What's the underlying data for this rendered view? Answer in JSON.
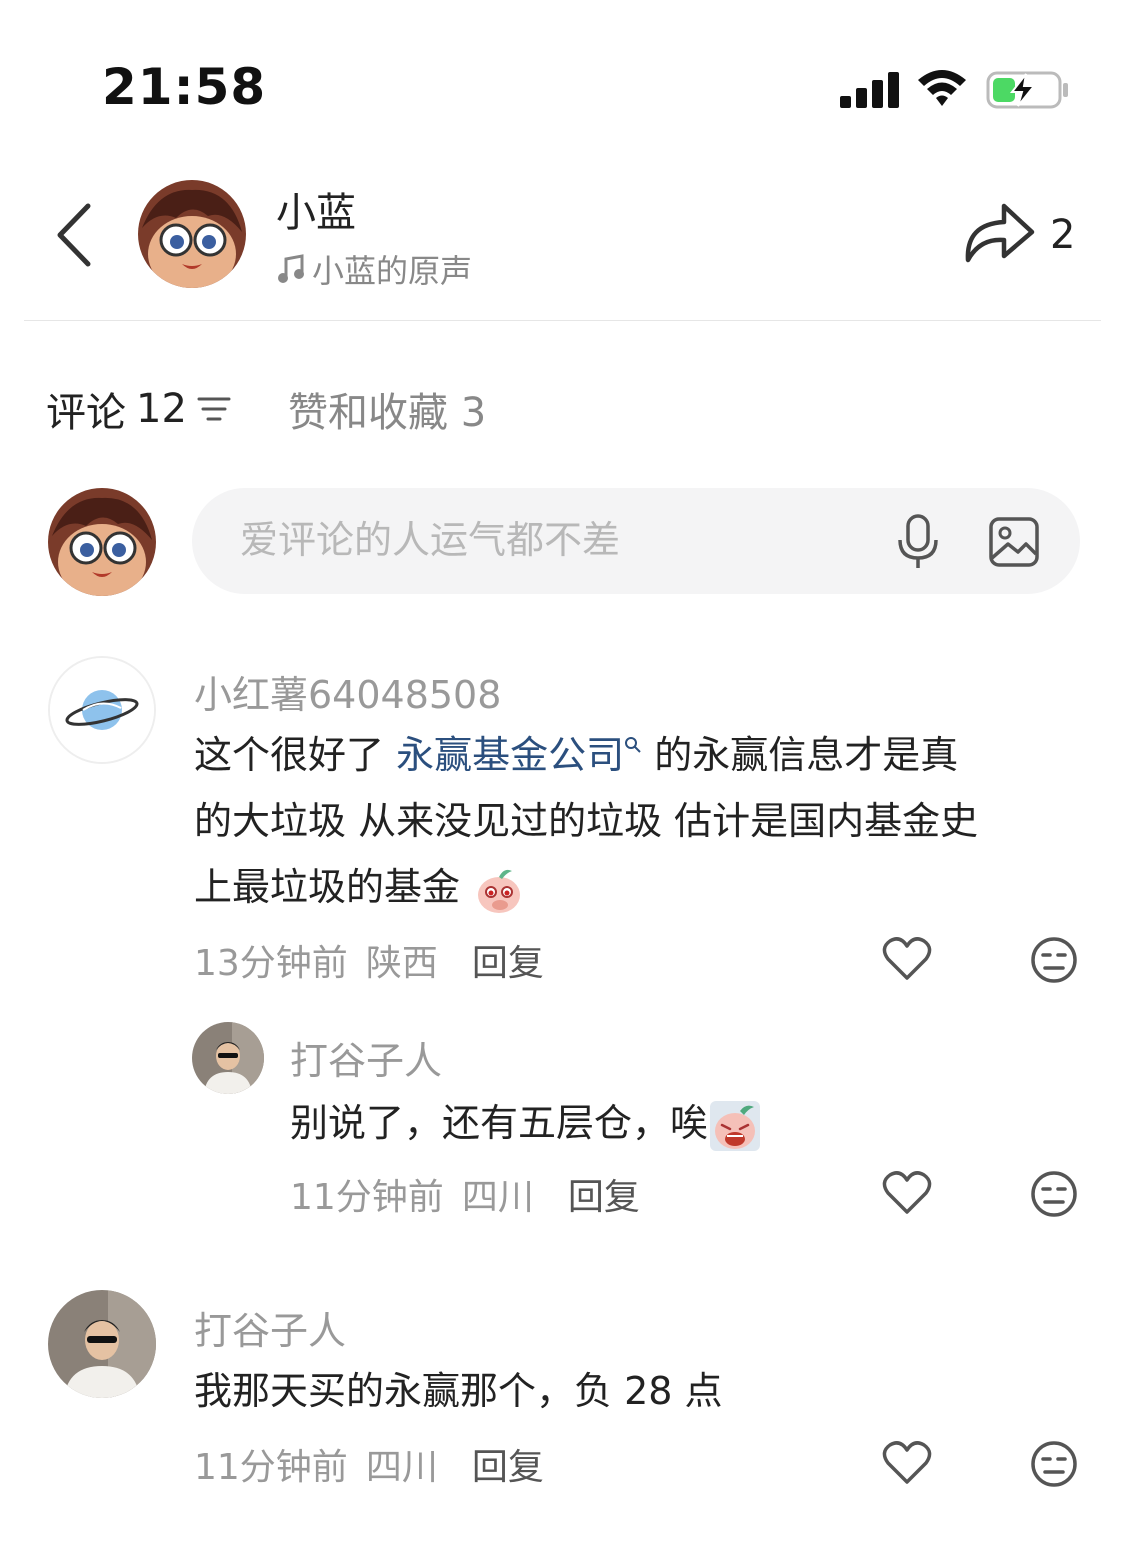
{
  "status_bar": {
    "time": "21:58"
  },
  "header": {
    "username": "小蓝",
    "sound": "小蓝的原声",
    "share_count": "2"
  },
  "tabs": {
    "comments_label": "评论",
    "comments_count": "12",
    "likes_label": "赞和收藏",
    "likes_count": "3"
  },
  "composer": {
    "placeholder": "爱评论的人运气都不差"
  },
  "comments": [
    {
      "author": "小红薯64048508",
      "text_before": "这个很好了 ",
      "link": "永赢基金公司",
      "text_line1_after": " 的永赢信息才是真",
      "text_line2": "的大垃圾 从来没见过的垃圾 估计是国内基金史",
      "text_line3": "上最垃圾的基金",
      "time": "13分钟前",
      "location": "陕西",
      "reply": "回复"
    },
    {
      "author": "打谷子人",
      "text": "别说了，还有五层仓，唉",
      "time": "11分钟前",
      "location": "四川",
      "reply": "回复"
    },
    {
      "author": "打谷子人",
      "text": "我那天买的永赢那个，负 28 点",
      "time": "11分钟前",
      "location": "四川",
      "reply": "回复"
    }
  ],
  "colors": {
    "link": "#2b4f7e",
    "muted": "#999999",
    "input_bg": "#f4f4f5",
    "battery_green": "#4cd964"
  }
}
